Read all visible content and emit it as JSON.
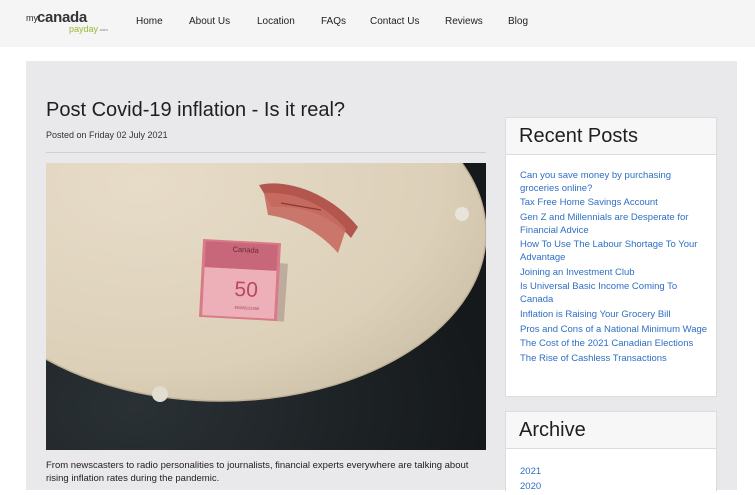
{
  "brand": {
    "logo_my": "my",
    "logo_canada": "canada",
    "logo_payday": "payday",
    "logo_com": ".com"
  },
  "nav": {
    "items": [
      {
        "label": "Home"
      },
      {
        "label": "About Us"
      },
      {
        "label": "Location"
      },
      {
        "label": "FAQs"
      },
      {
        "label": "Contact Us"
      },
      {
        "label": "Reviews"
      },
      {
        "label": "Blog"
      }
    ]
  },
  "post": {
    "title": "Post Covid-19 inflation - Is it real?",
    "posted": "Posted on Friday 02 July 2021",
    "image": {
      "banknote_label": "Canada",
      "banknote_value": "50",
      "banknote_serial": "EBW0123456"
    },
    "excerpt": "From newscasters to radio personalities to journalists, financial experts everywhere are talking about rising inflation rates during the pandemic."
  },
  "sidebar": {
    "recent_title": "Recent Posts",
    "recent_posts": [
      "Can you save money by purchasing groceries online?",
      "Tax Free Home Savings Account",
      "Gen Z and Millennials are Desperate for Financial Advice",
      "How To Use The Labour Shortage To Your Advantage",
      "Joining an Investment Club",
      "Is Universal Basic Income Coming To Canada",
      "Inflation is Raising Your Grocery Bill",
      "Pros and Cons of a National Minimum Wage",
      "The Cost of the 2021 Canadian Elections",
      "The Rise of Cashless Transactions"
    ],
    "archive_title": "Archive",
    "archive": [
      "2021",
      "2020"
    ]
  },
  "colors": {
    "link": "#2e6fc4",
    "accent": "#9ab933",
    "content_bg": "#e9e9ec"
  }
}
